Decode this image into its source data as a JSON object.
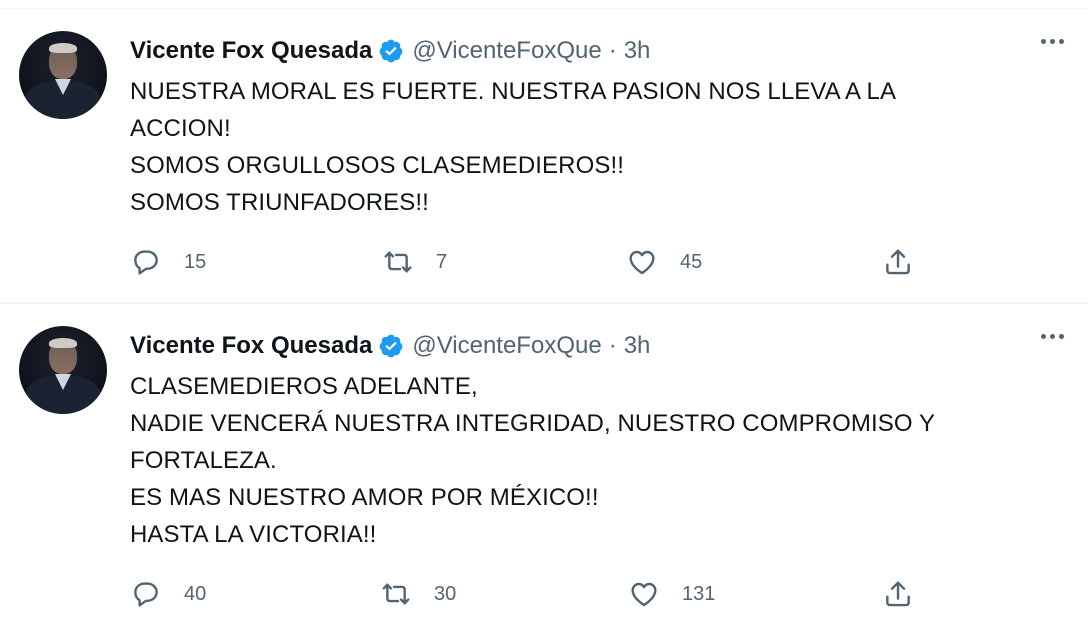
{
  "tweets": [
    {
      "name": "Vicente Fox Quesada",
      "handle": "@VicenteFoxQue",
      "separator": "·",
      "time": "3h",
      "lines": [
        "NUESTRA MORAL ES FUERTE. NUESTRA PASION NOS LLEVA A LA",
        "ACCION!",
        "SOMOS ORGULLOSOS CLASEMEDIEROS!!",
        "SOMOS TRIUNFADORES!!"
      ],
      "replies": "15",
      "retweets": "7",
      "likes": "45"
    },
    {
      "name": "Vicente Fox Quesada",
      "handle": "@VicenteFoxQue",
      "separator": "·",
      "time": "3h",
      "lines": [
        "CLASEMEDIEROS ADELANTE,",
        "NADIE VENCERÁ NUESTRA INTEGRIDAD, NUESTRO COMPROMISO Y",
        "FORTALEZA.",
        "ES MAS NUESTRO AMOR POR MÉXICO!!",
        "HASTA LA VICTORIA!!"
      ],
      "replies": "40",
      "retweets": "30",
      "likes": "131"
    }
  ],
  "icons": {
    "reply": "reply-icon",
    "retweet": "retweet-icon",
    "like": "heart-icon",
    "share": "share-icon",
    "more": "more-icon",
    "verified": "verified-badge-icon"
  },
  "colors": {
    "verified_blue": "#1d9bf0",
    "secondary_text": "#536471",
    "primary_text": "#0f1419"
  }
}
